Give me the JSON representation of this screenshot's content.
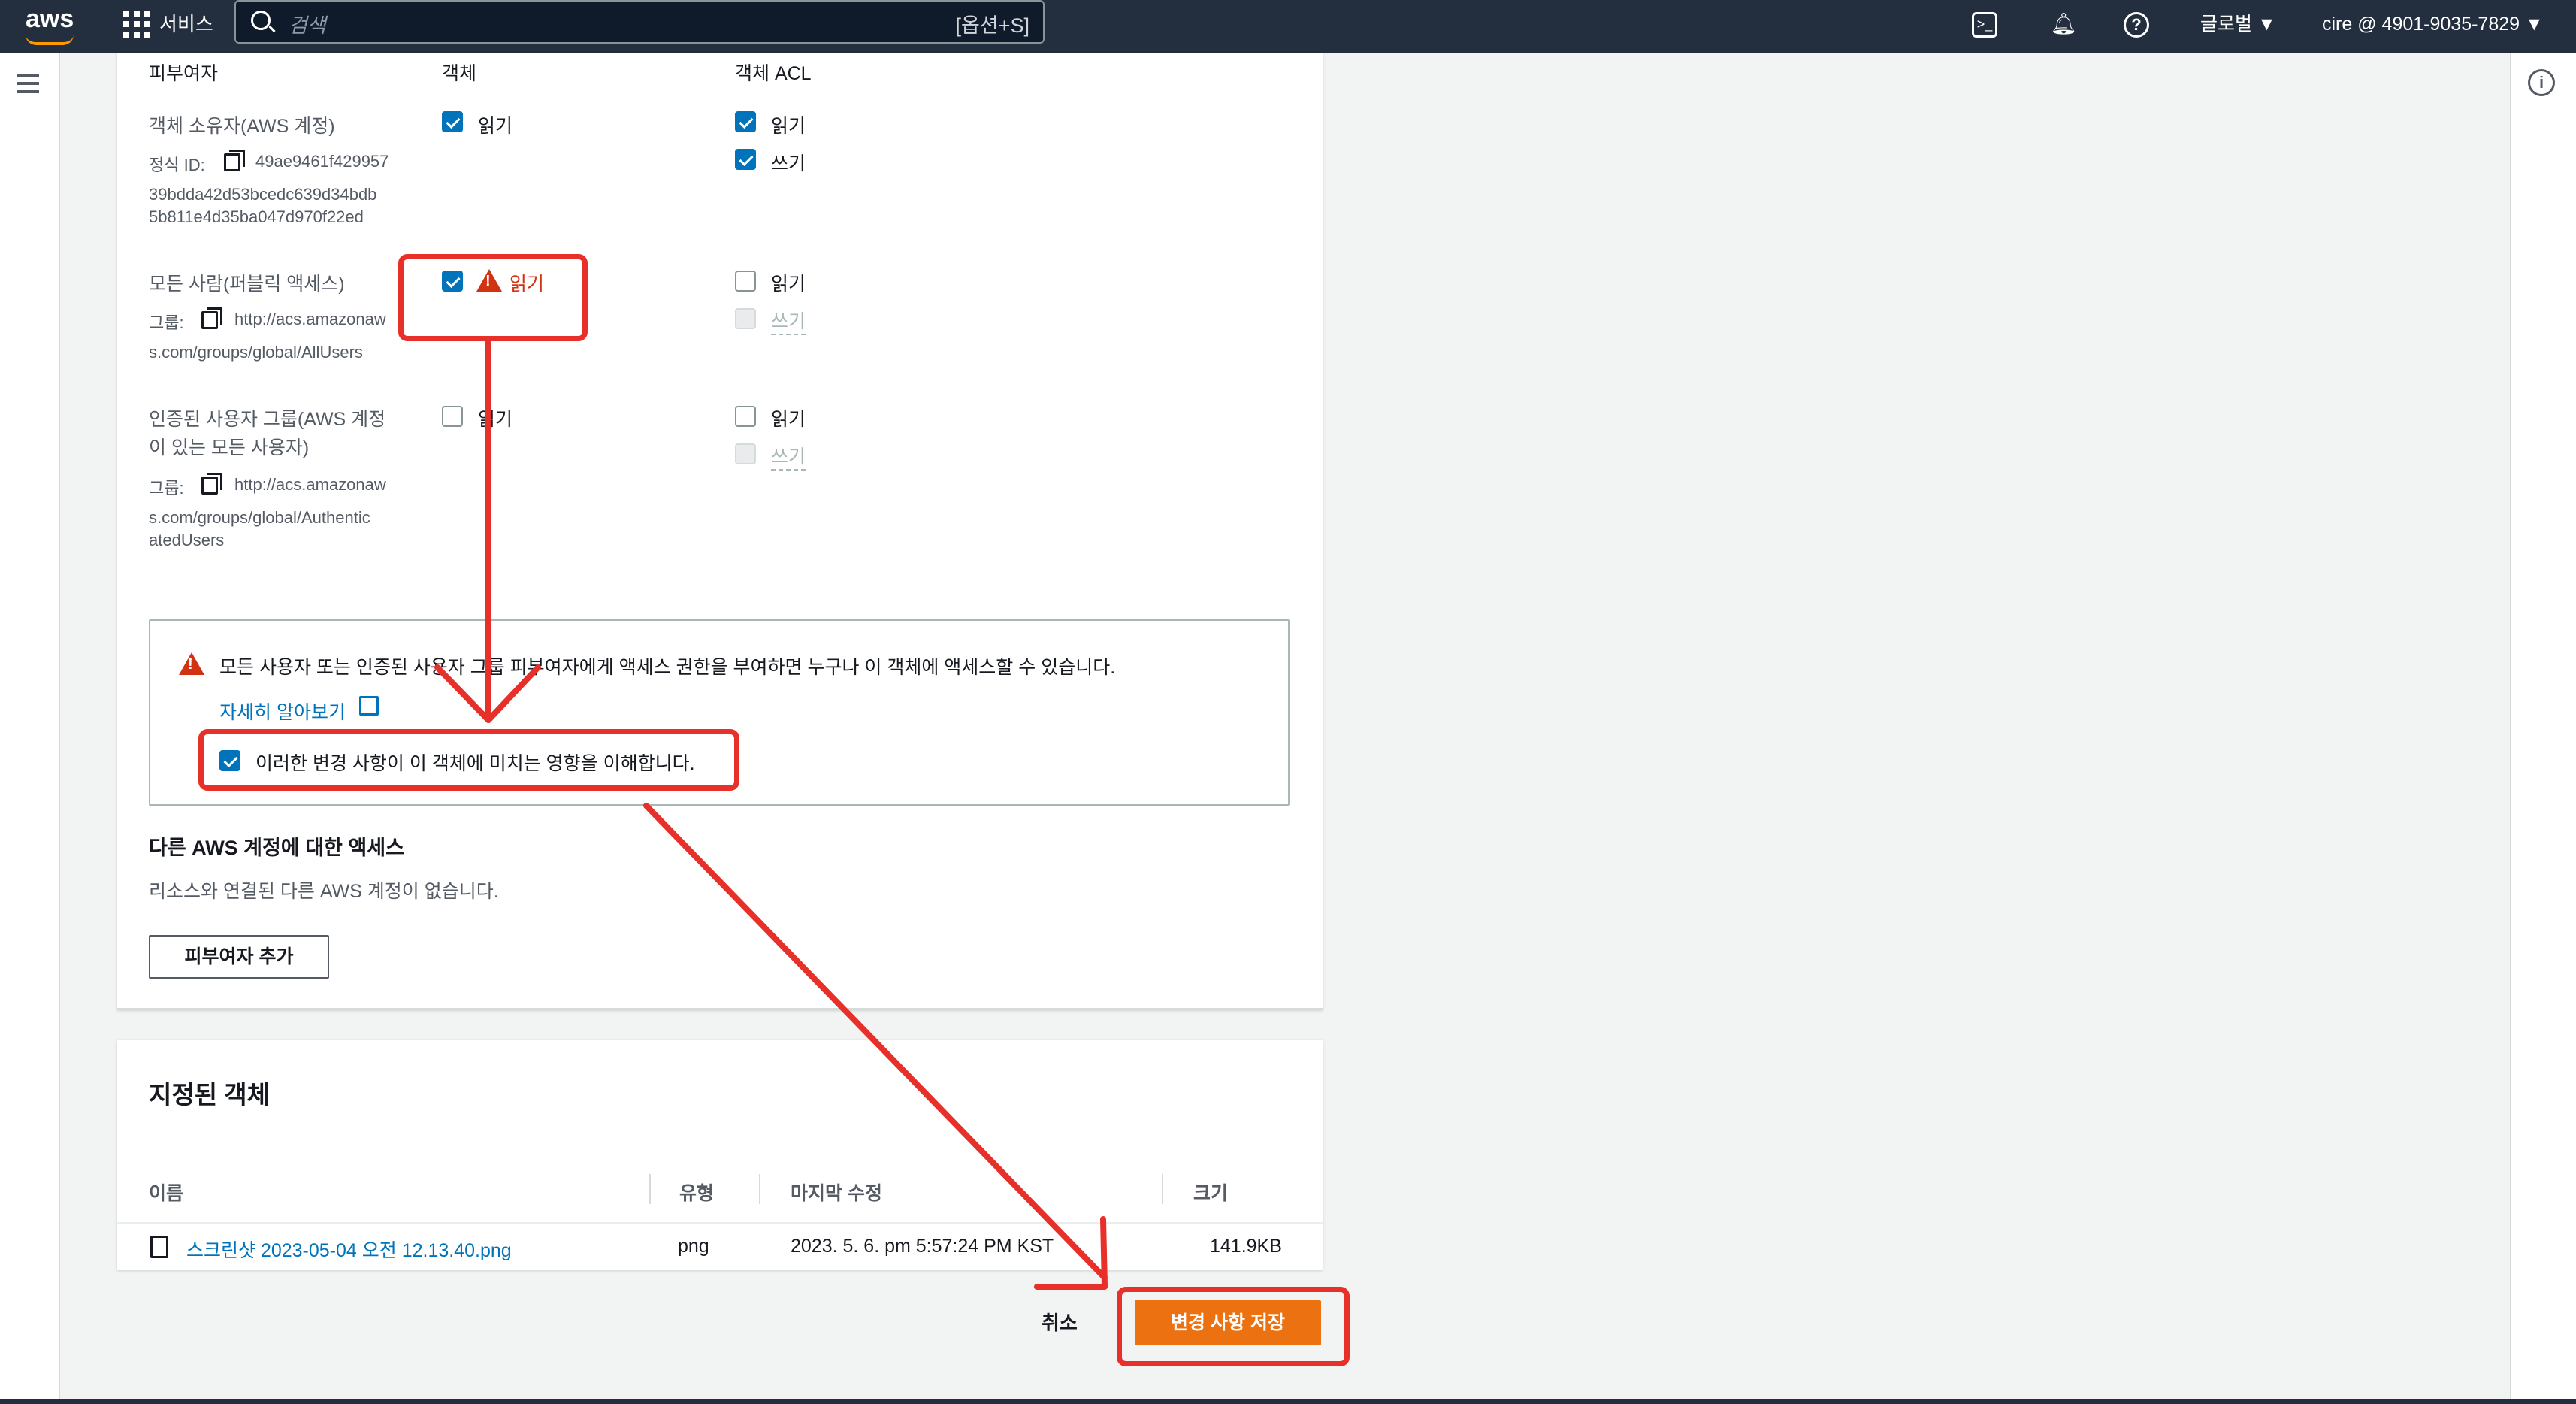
{
  "nav": {
    "logo": "aws",
    "services_label": "서비스",
    "search_placeholder": "검색",
    "search_shortcut": "[옵션+S]",
    "region": "글로벌 ▼",
    "account": "cire @ 4901-9035-7829 ▼"
  },
  "grantee_table": {
    "headers": {
      "grantee": "피부여자",
      "object": "객체",
      "acl": "객체 ACL"
    },
    "rows": [
      {
        "grantee": "객체 소유자(AWS 계정)",
        "id_label": "정식 ID:",
        "id_line1": "49ae9461f429957",
        "id_line2": "39bdda42d53bcedc639d34bdb",
        "id_line3": "5b811e4d35ba047d970f22ed",
        "object_read": "읽기",
        "acl_read": "읽기",
        "acl_write": "쓰기"
      },
      {
        "grantee": "모든 사람(퍼블릭 액세스)",
        "group_label": "그룹:",
        "group_line1": "http://acs.amazonaw",
        "group_line2": "s.com/groups/global/AllUsers",
        "object_read": "읽기",
        "acl_read": "읽기",
        "acl_write": "쓰기"
      },
      {
        "grantee_line1": "인증된 사용자 그룹(AWS 계정",
        "grantee_line2": "이 있는 모든 사용자)",
        "group_label": "그룹:",
        "group_line1": "http://acs.amazonaw",
        "group_line2": "s.com/groups/global/Authentic",
        "group_line3": "atedUsers",
        "object_read": "읽기",
        "acl_read": "읽기",
        "acl_write": "쓰기"
      }
    ]
  },
  "alert": {
    "message": "모든 사용자 또는 인증된 사용자 그룹 피부여자에게 액세스 권한을 부여하면 누구나 이 객체에 액세스할 수 있습니다.",
    "learn_more": "자세히 알아보기",
    "ack_label": "이러한 변경 사항이 이 객체에 미치는 영향을 이해합니다."
  },
  "other_accounts": {
    "title": "다른 AWS 계정에 대한 액세스",
    "empty": "리소스와 연결된 다른 AWS 계정이 없습니다.",
    "add_button": "피부여자 추가"
  },
  "specified_objects": {
    "title": "지정된 객체",
    "columns": [
      "이름",
      "유형",
      "마지막 수정",
      "크기"
    ],
    "rows": [
      {
        "name": "스크린샷 2023-05-04 오전 12.13.40.png",
        "type": "png",
        "modified": "2023. 5. 6. pm 5:57:24 PM KST",
        "size": "141.9KB"
      }
    ]
  },
  "footer_actions": {
    "cancel": "취소",
    "save": "변경 사항 저장"
  },
  "colors": {
    "nav_bg": "#232f3e",
    "primary": "#ec7211",
    "link": "#0073bb",
    "warning": "#d13212",
    "annotation": "#e7302a"
  }
}
